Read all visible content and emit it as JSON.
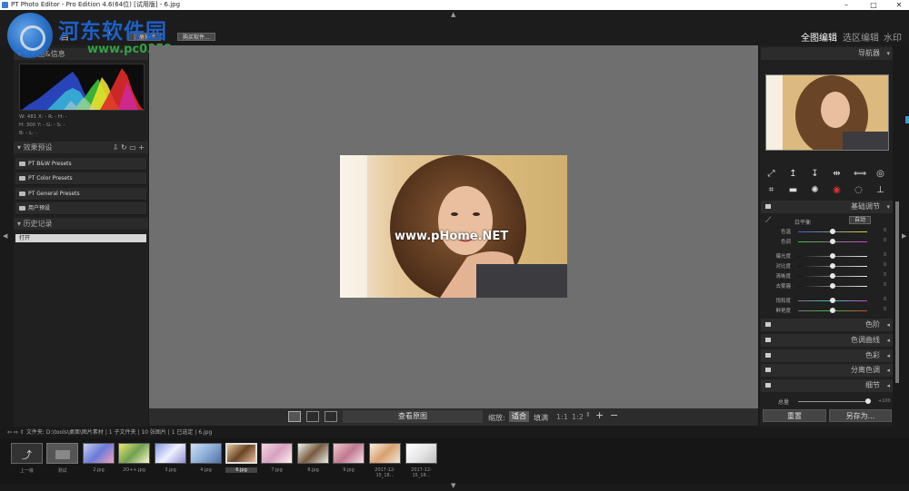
{
  "window": {
    "title": "PT Photo Editor - Pro Edition 4.6(64位) [试用版] - 6.jpg",
    "controls": [
      "–",
      "□",
      "✕"
    ]
  },
  "watermark": {
    "title": "河东软件园",
    "url": "www.pc0359.cn"
  },
  "photo_watermark": "www.pHome.NET",
  "topbar": {
    "left_menu_glyphs": [
      "目",
      "?"
    ],
    "register_label": "注册激活",
    "buy_label": "购买软件...",
    "mode_tabs": [
      "全图编辑",
      "选区编辑",
      "水印"
    ]
  },
  "left_panel": {
    "histogram_title": "分布图&信息",
    "info_rows": [
      "W:  481  X:    -   R:    -    H:    -",
      "H:  300  Y:    -   G:    -    S:    -",
      "                        B:    -    L:    -"
    ],
    "presets_title": "效果预设",
    "presets": [
      "PT B&W Presets",
      "PT Color Presets",
      "PT General Presets",
      "用户预设"
    ],
    "history_title": "历史记录",
    "history_items": [
      "打开"
    ]
  },
  "view_bar": {
    "compare_label": "查看原图",
    "zoom_label": "缩放:",
    "fit_label": "适合",
    "fill_label": "填满",
    "ratio_1_1": "1:1",
    "ratio_1_2": "1:2",
    "plus": "+",
    "minus": "−"
  },
  "right_panel": {
    "navigator_title": "导航器",
    "basic_title": "基础调节",
    "white_balance_label": "白平衡",
    "auto_button": "自动",
    "sliders": [
      {
        "label": "色温",
        "value": "0"
      },
      {
        "label": "色调",
        "value": "0"
      },
      {
        "label": "曝光度",
        "value": "0"
      },
      {
        "label": "对比度",
        "value": "0"
      },
      {
        "label": "清晰度",
        "value": "0"
      },
      {
        "label": "去雾霾",
        "value": "0"
      },
      {
        "label": "饱和度",
        "value": "0"
      },
      {
        "label": "鲜艳度",
        "value": "0"
      }
    ],
    "collapsed_sections": [
      "色阶",
      "色调曲线",
      "色彩",
      "分离色调",
      "细节"
    ],
    "total_label": "总量",
    "total_value": "+100",
    "reset_button": "重置",
    "save_as_button": "另存为..."
  },
  "path_bar": {
    "text": "文件夹:  D:\\tools\\桌面\\图片素材  |  1 子文件夹  |  10 张图片  |  1 已选定  |  6.jpg"
  },
  "filmstrip": [
    {
      "label": "上一级"
    },
    {
      "label": "测试"
    },
    {
      "label": "2.jpg"
    },
    {
      "label": "2O++.jpg"
    },
    {
      "label": "3.jpg"
    },
    {
      "label": "4.jpg"
    },
    {
      "label": "6.jpg"
    },
    {
      "label": "7.jpg"
    },
    {
      "label": "8.jpg"
    },
    {
      "label": "9.jpg"
    },
    {
      "label": "2017-12-15_18..."
    },
    {
      "label": "2017-12-15_18..."
    }
  ]
}
